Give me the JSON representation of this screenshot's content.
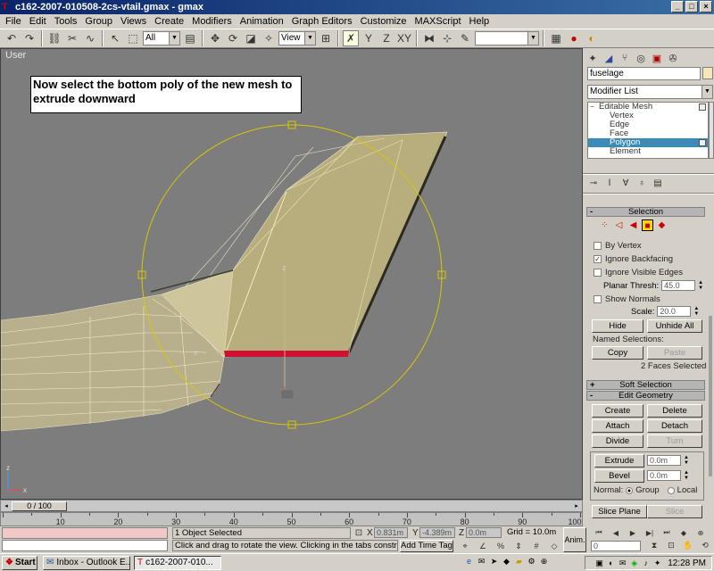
{
  "window": {
    "title": "c162-2007-010508-2cs-vtail.gmax - gmax",
    "buttons": [
      "_",
      "□",
      "×"
    ]
  },
  "menu": [
    "File",
    "Edit",
    "Tools",
    "Group",
    "Views",
    "Create",
    "Modifiers",
    "Animation",
    "Graph Editors",
    "Customize",
    "MAXScript",
    "Help"
  ],
  "toolbar": {
    "selection_filter": "All",
    "ref_coord": "View",
    "named_selection": ""
  },
  "viewport": {
    "label": "User",
    "annotation": "Now select the bottom poly of the new mesh to extrude downward",
    "axis_labels": {
      "x": "x",
      "z": "z"
    }
  },
  "panel": {
    "object_name": "fuselage",
    "modifier_list": "Modifier List",
    "stack": [
      {
        "label": "Editable Mesh",
        "level": "top"
      },
      {
        "label": "Vertex",
        "level": "sub"
      },
      {
        "label": "Edge",
        "level": "sub"
      },
      {
        "label": "Face",
        "level": "sub"
      },
      {
        "label": "Polygon",
        "level": "sub",
        "selected": true
      },
      {
        "label": "Element",
        "level": "sub"
      }
    ],
    "selection": {
      "title": "Selection",
      "by_vertex": "By Vertex",
      "ignore_backfacing": "Ignore Backfacing",
      "ignore_visible_edges": "Ignore Visible Edges",
      "planar_thresh_label": "Planar Thresh:",
      "planar_thresh_value": "45.0",
      "show_normals": "Show Normals",
      "scale_label": "Scale:",
      "scale_value": "20.0",
      "hide": "Hide",
      "unhide_all": "Unhide All",
      "named_selections": "Named Selections:",
      "copy": "Copy",
      "paste": "Paste",
      "status": "2 Faces Selected"
    },
    "soft_selection": {
      "title": "Soft Selection"
    },
    "edit_geometry": {
      "title": "Edit Geometry",
      "create": "Create",
      "delete": "Delete",
      "attach": "Attach",
      "detach": "Detach",
      "divide": "Divide",
      "turn": "Turn",
      "extrude": "Extrude",
      "extrude_value": "0.0m",
      "bevel": "Bevel",
      "bevel_value": "0.0m",
      "normal_label": "Normal:",
      "group": "Group",
      "local": "Local",
      "slice_plane": "Slice Plane",
      "slice": "Slice"
    }
  },
  "timeline": {
    "slider_label": "0 / 100",
    "ticks": [
      "10",
      "20",
      "30",
      "40",
      "50",
      "60",
      "70",
      "80",
      "90",
      "100"
    ]
  },
  "status": {
    "objects_selected": "1 Object Selected",
    "prompt": "Click and drag to rotate the view.  Clicking in the tabs constrains the r",
    "x_label": "X",
    "x_value": "0.831m",
    "y_label": "Y",
    "y_value": "-4.389m",
    "z_label": "Z",
    "z_value": "0.0m",
    "grid": "Grid = 10.0m",
    "add_time_tag": "Add Time Tag",
    "anim": "Anim.",
    "frame": "0"
  },
  "taskbar": {
    "start": "Start",
    "tasks": [
      {
        "label": "Inbox - Outlook E...",
        "active": false
      },
      {
        "label": "c162-2007-010...",
        "active": true
      }
    ],
    "clock": "12:28 PM"
  }
}
